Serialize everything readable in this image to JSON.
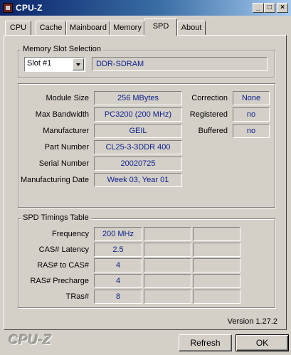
{
  "window": {
    "title": "CPU-Z",
    "minimize": "_",
    "maximize": "□",
    "close": "×"
  },
  "tabs": [
    {
      "label": "CPU"
    },
    {
      "label": "Cache"
    },
    {
      "label": "Mainboard"
    },
    {
      "label": "Memory"
    },
    {
      "label": "SPD"
    },
    {
      "label": "About"
    }
  ],
  "active_tab": "SPD",
  "slot": {
    "group_title": "Memory Slot Selection",
    "selected": "Slot #1",
    "type": "DDR-SDRAM"
  },
  "module": {
    "rows": [
      {
        "label": "Module Size",
        "value": "256 MBytes"
      },
      {
        "label": "Max Bandwidth",
        "value": "PC3200 (200 MHz)"
      },
      {
        "label": "Manufacturer",
        "value": "GEIL"
      },
      {
        "label": "Part Number",
        "value": "CL25-3-3DDR 400"
      },
      {
        "label": "Serial Number",
        "value": "20020725"
      },
      {
        "label": "Manufacturing Date",
        "value": "Week 03, Year 01"
      }
    ],
    "flags": [
      {
        "label": "Correction",
        "value": "None"
      },
      {
        "label": "Registered",
        "value": "no"
      },
      {
        "label": "Buffered",
        "value": "no"
      }
    ]
  },
  "timings": {
    "group_title": "SPD Timings Table",
    "rows": [
      {
        "label": "Frequency",
        "value": "200 MHz"
      },
      {
        "label": "CAS# Latency",
        "value": "2.5"
      },
      {
        "label": "RAS# to CAS#",
        "value": "4"
      },
      {
        "label": "RAS# Precharge",
        "value": "4"
      },
      {
        "label": "TRas#",
        "value": "8"
      }
    ]
  },
  "footer": {
    "version": "Version 1.27.2",
    "brand": "CPU-Z",
    "refresh_label": "Refresh",
    "ok_label": "OK"
  }
}
